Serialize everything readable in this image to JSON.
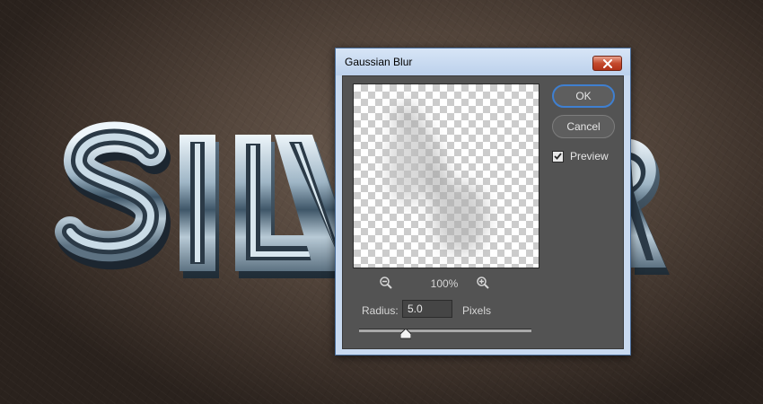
{
  "dialog": {
    "title": "Gaussian Blur",
    "ok_label": "OK",
    "cancel_label": "Cancel",
    "preview_checkbox": {
      "label": "Preview",
      "checked": true
    },
    "zoom_level": "100%",
    "radius": {
      "label": "Radius:",
      "value": "5.0",
      "units": "Pixels"
    },
    "slider_value_fraction": 0.27
  },
  "artwork": {
    "text": "SILVER"
  },
  "colors": {
    "accent": "#3f7fd0",
    "panel": "#535353",
    "close": "#c44a2d"
  }
}
